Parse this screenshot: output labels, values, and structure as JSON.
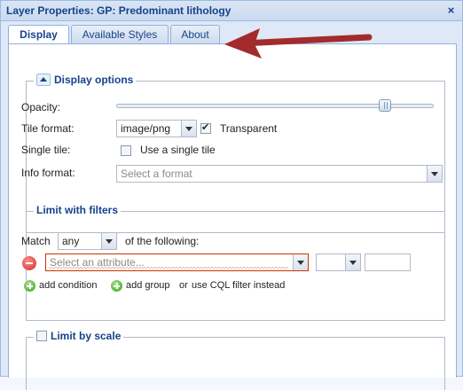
{
  "window": {
    "title": "Layer Properties: GP: Predominant lithology",
    "close_label": "×"
  },
  "tabs": [
    {
      "label": "Display",
      "active": true
    },
    {
      "label": "Available Styles",
      "active": false
    },
    {
      "label": "About",
      "active": false
    }
  ],
  "display_options": {
    "legend": "Display options",
    "opacity_label": "Opacity:",
    "opacity_value": 0.86,
    "tile_format_label": "Tile format:",
    "tile_format_value": "image/png",
    "transparent_label": "Transparent",
    "transparent_checked": true,
    "single_tile_label": "Single tile:",
    "single_tile_option": "Use a single tile",
    "single_tile_checked": false,
    "info_format_label": "Info format:",
    "info_format_placeholder": "Select a format"
  },
  "filters": {
    "legend": "Limit with filters",
    "match_label": "Match",
    "match_value": "any",
    "following_label": "of the following:",
    "attribute_placeholder": "Select an attribute...",
    "add_condition": "add condition",
    "add_group": "add group",
    "or_label": "or",
    "cql_link": "use CQL filter instead"
  },
  "scale": {
    "legend": "Limit by scale",
    "checked": false
  },
  "colors": {
    "accent": "#15428b",
    "border": "#99bbe8",
    "arrow": "#a32b2b"
  }
}
